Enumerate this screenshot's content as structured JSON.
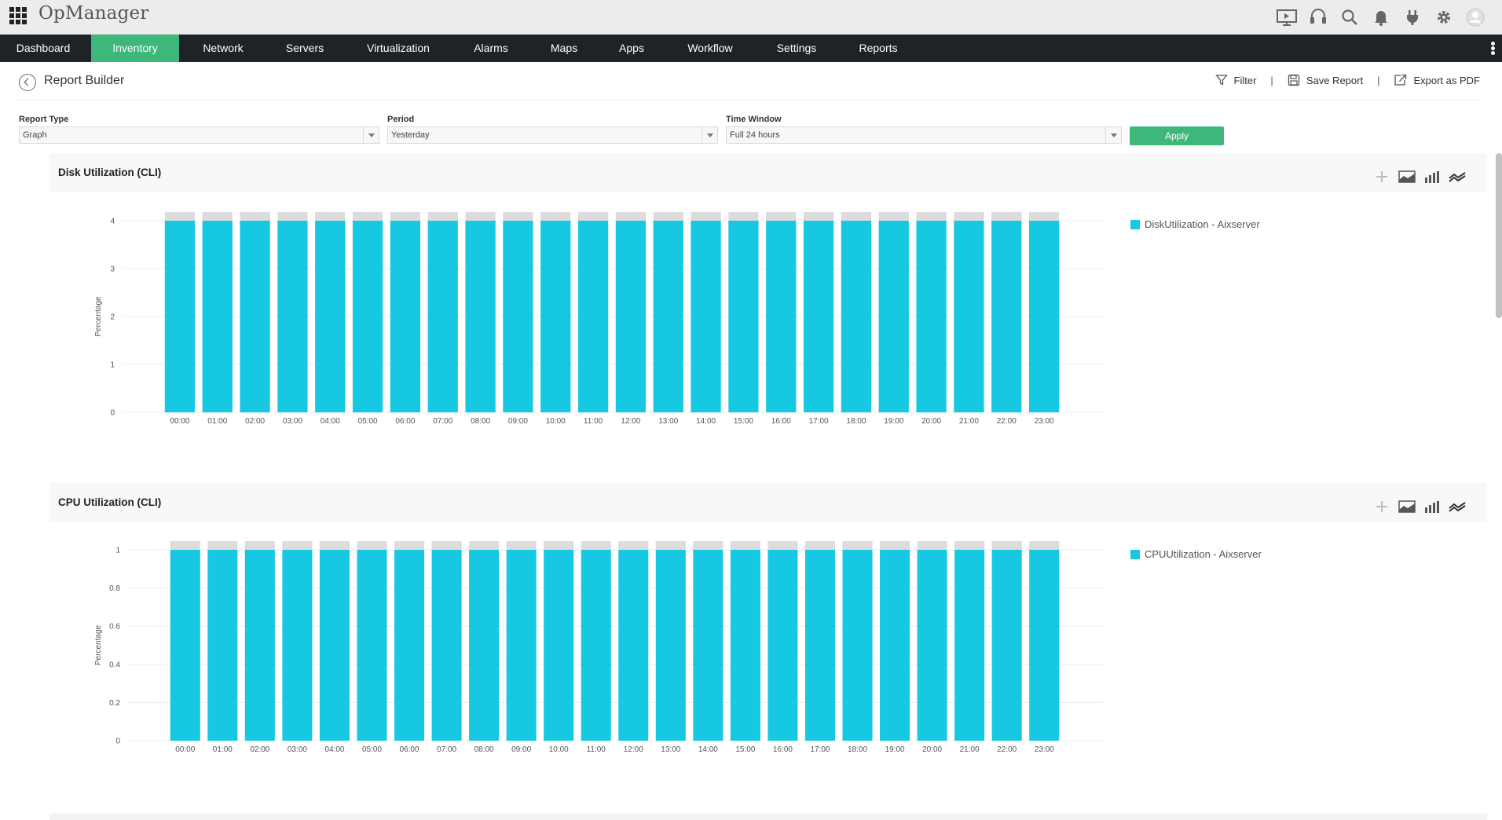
{
  "app": {
    "brand": "OpManager"
  },
  "topbar_icons": [
    "presentation-icon",
    "headset-icon",
    "search-icon",
    "bell-icon",
    "plug-icon",
    "gear-icon",
    "user-avatar-icon"
  ],
  "nav": {
    "items": [
      {
        "label": "Dashboard",
        "active": false
      },
      {
        "label": "Inventory",
        "active": true
      },
      {
        "label": "Network",
        "active": false
      },
      {
        "label": "Servers",
        "active": false
      },
      {
        "label": "Virtualization",
        "active": false
      },
      {
        "label": "Alarms",
        "active": false
      },
      {
        "label": "Maps",
        "active": false
      },
      {
        "label": "Apps",
        "active": false
      },
      {
        "label": "Workflow",
        "active": false
      },
      {
        "label": "Settings",
        "active": false
      },
      {
        "label": "Reports",
        "active": false
      }
    ]
  },
  "header": {
    "title": "Report Builder",
    "filter_label": "Filter",
    "save_label": "Save Report",
    "export_label": "Export as PDF",
    "separator": "|"
  },
  "filters": {
    "report_type": {
      "label": "Report Type",
      "value": "Graph"
    },
    "period": {
      "label": "Period",
      "value": "Yesterday"
    },
    "time_window": {
      "label": "Time Window",
      "value": "Full 24 hours"
    },
    "apply_label": "Apply"
  },
  "colors": {
    "accent": "#3eb77a",
    "bar": "#17c8e3",
    "bar_cap": "#dcdcdc",
    "navbar": "#202326"
  },
  "chart_data": [
    {
      "type": "bar",
      "title": "Disk Utilization (CLI)",
      "ylabel": "Percentage",
      "xlabel": "",
      "ylim": [
        0,
        4
      ],
      "yticks": [
        "0",
        "1",
        "2",
        "3",
        "4"
      ],
      "categories": [
        "00:00",
        "01:00",
        "02:00",
        "03:00",
        "04:00",
        "05:00",
        "06:00",
        "07:00",
        "08:00",
        "09:00",
        "10:00",
        "11:00",
        "12:00",
        "13:00",
        "14:00",
        "15:00",
        "16:00",
        "17:00",
        "18:00",
        "19:00",
        "20:00",
        "21:00",
        "22:00",
        "23:00"
      ],
      "series": [
        {
          "name": "DiskUtilization - Aixserver",
          "values": [
            4,
            4,
            4,
            4,
            4,
            4,
            4,
            4,
            4,
            4,
            4,
            4,
            4,
            4,
            4,
            4,
            4,
            4,
            4,
            4,
            4,
            4,
            4,
            4
          ]
        }
      ],
      "grid": true,
      "legend": "right"
    },
    {
      "type": "bar",
      "title": "CPU Utilization (CLI)",
      "ylabel": "Percentage",
      "xlabel": "",
      "ylim": [
        0,
        1
      ],
      "yticks": [
        "0",
        "0.2",
        "0.4",
        "0.6",
        "0.8",
        "1"
      ],
      "categories": [
        "00:00",
        "01:00",
        "02:00",
        "03:00",
        "04:00",
        "05:00",
        "06:00",
        "07:00",
        "08:00",
        "09:00",
        "10:00",
        "11:00",
        "12:00",
        "13:00",
        "14:00",
        "15:00",
        "16:00",
        "17:00",
        "18:00",
        "19:00",
        "20:00",
        "21:00",
        "22:00",
        "23:00"
      ],
      "series": [
        {
          "name": "CPUUtilization - Aixserver",
          "values": [
            1,
            1,
            1,
            1,
            1,
            1,
            1,
            1,
            1,
            1,
            1,
            1,
            1,
            1,
            1,
            1,
            1,
            1,
            1,
            1,
            1,
            1,
            1,
            1
          ]
        }
      ],
      "grid": true,
      "legend": "right"
    }
  ]
}
